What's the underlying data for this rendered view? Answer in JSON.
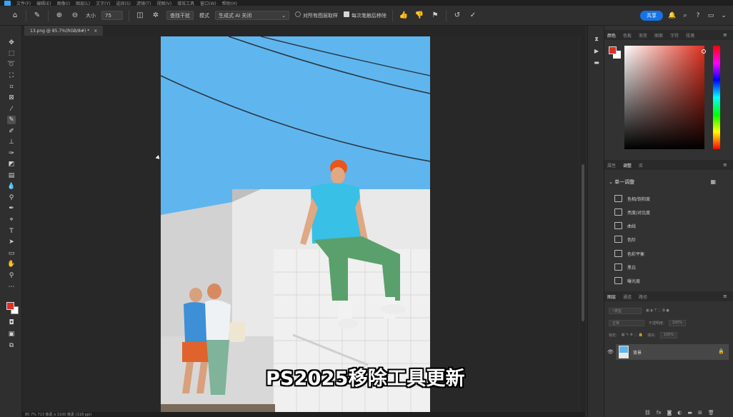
{
  "menubar": {
    "items": [
      "文件(F)",
      "编辑(E)",
      "图像(I)",
      "图层(L)",
      "文字(Y)",
      "选择(S)",
      "滤镜(T)",
      "视图(V)",
      "增效工具",
      "窗口(W)",
      "帮助(H)"
    ]
  },
  "options_bar": {
    "size_label": "大小",
    "size_value": "75",
    "mode_button": "查找干扰",
    "mode_label": "模式",
    "mode_value": "生成式 AI 关闭",
    "sample_all_label": "对所有图层取样",
    "remove_after_label": "每次笔触后移除",
    "share_label": "共享"
  },
  "document": {
    "tab_title": "13.png @ 85.7%(RGB/8#) *",
    "status": "85.7%    713 像素 x 1100 像素 (118 ppi)"
  },
  "colors": {
    "foreground": "#e0301e",
    "background": "#ffffff",
    "accent": "#1473e6"
  },
  "color_panel": {
    "tabs": [
      "颜色",
      "色板",
      "渐变",
      "图案",
      "字符",
      "段落"
    ]
  },
  "adjustments_panel": {
    "tabs": [
      "属性",
      "调整",
      "库"
    ],
    "section_title": "单一调整",
    "items": [
      {
        "label": "色相/饱和度",
        "icon": "hue-saturation-icon"
      },
      {
        "label": "亮度/对比度",
        "icon": "brightness-contrast-icon"
      },
      {
        "label": "曲线",
        "icon": "curves-icon"
      },
      {
        "label": "色阶",
        "icon": "levels-icon"
      },
      {
        "label": "色彩平衡",
        "icon": "color-balance-icon"
      },
      {
        "label": "黑白",
        "icon": "black-white-icon"
      },
      {
        "label": "曝光度",
        "icon": "exposure-icon"
      }
    ]
  },
  "layers_panel": {
    "tabs": [
      "图层",
      "通道",
      "路径"
    ],
    "search_placeholder": "类型",
    "blend_mode": "正常",
    "opacity_label": "不透明度:",
    "opacity_value": "100%",
    "lock_label": "锁定:",
    "fill_label": "填充:",
    "fill_value": "100%",
    "layer_name": "背景"
  },
  "caption": "PS2025移除工具更新"
}
